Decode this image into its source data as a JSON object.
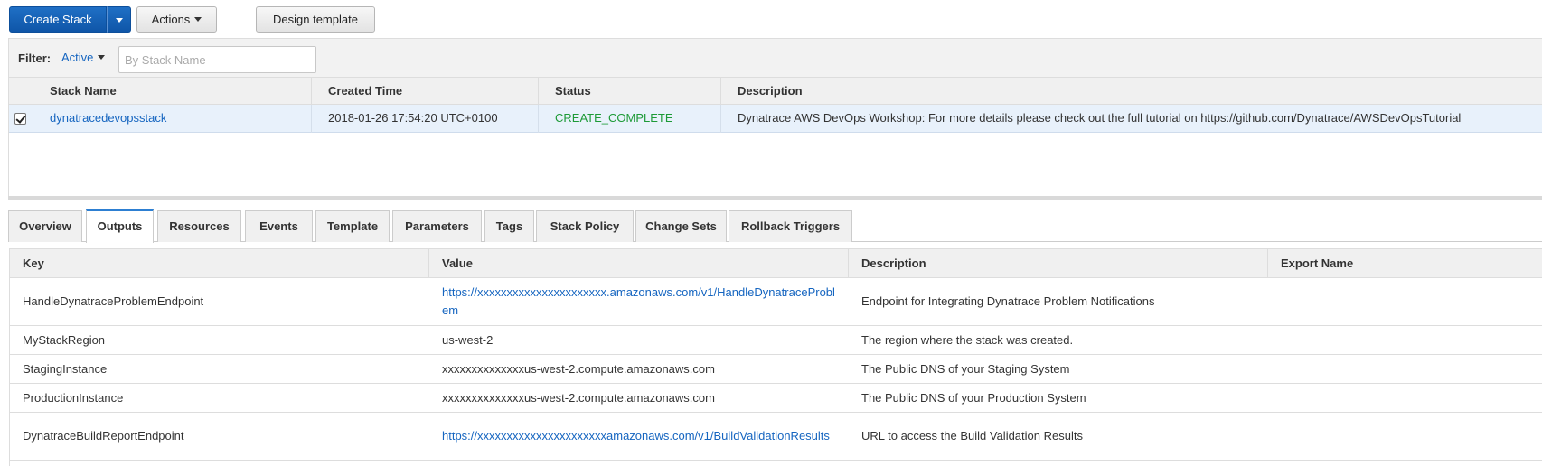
{
  "toolbar": {
    "create_stack": "Create Stack",
    "actions": "Actions",
    "design_template": "Design template"
  },
  "filter": {
    "label": "Filter:",
    "active": "Active",
    "search_placeholder": "By Stack Name"
  },
  "stacks": {
    "headers": [
      "Stack Name",
      "Created Time",
      "Status",
      "Description"
    ],
    "rows": [
      {
        "checked": true,
        "name": "dynatracedevopsstack",
        "created": "2018-01-26 17:54:20 UTC+0100",
        "status": "CREATE_COMPLETE",
        "description": "Dynatrace AWS DevOps Workshop: For more details please check out the full tutorial on https://github.com/Dynatrace/AWSDevOpsTutorial"
      }
    ]
  },
  "tabs": [
    "Overview",
    "Outputs",
    "Resources",
    "Events",
    "Template",
    "Parameters",
    "Tags",
    "Stack Policy",
    "Change Sets",
    "Rollback Triggers"
  ],
  "active_tab": "Outputs",
  "outputs": {
    "headers": [
      "Key",
      "Value",
      "Description",
      "Export Name"
    ],
    "rows": [
      {
        "key": "HandleDynatraceProblemEndpoint",
        "value": "https://xxxxxxxxxxxxxxxxxxxxxx.amazonaws.com/v1/HandleDynatraceProblem",
        "value_is_link": true,
        "description": "Endpoint for Integrating Dynatrace Problem Notifications",
        "export": ""
      },
      {
        "key": "MyStackRegion",
        "value": "us-west-2",
        "value_is_link": false,
        "description": "The region where the stack was created.",
        "export": ""
      },
      {
        "key": "StagingInstance",
        "value": "xxxxxxxxxxxxxxus-west-2.compute.amazonaws.com",
        "value_is_link": false,
        "description": "The Public DNS of your Staging System",
        "export": ""
      },
      {
        "key": "ProductionInstance",
        "value": "xxxxxxxxxxxxxxus-west-2.compute.amazonaws.com",
        "value_is_link": false,
        "description": "The Public DNS of your Production System",
        "export": ""
      },
      {
        "key": "DynatraceBuildReportEndpoint",
        "value": "https://xxxxxxxxxxxxxxxxxxxxxxamazonaws.com/v1/BuildValidationResults",
        "value_is_link": true,
        "description": "URL to access the Build Validation Results",
        "export": ""
      }
    ]
  },
  "colors": {
    "primary": "#1565c0",
    "status_complete": "#1d9a37",
    "selected_row": "#e8f1fb"
  }
}
